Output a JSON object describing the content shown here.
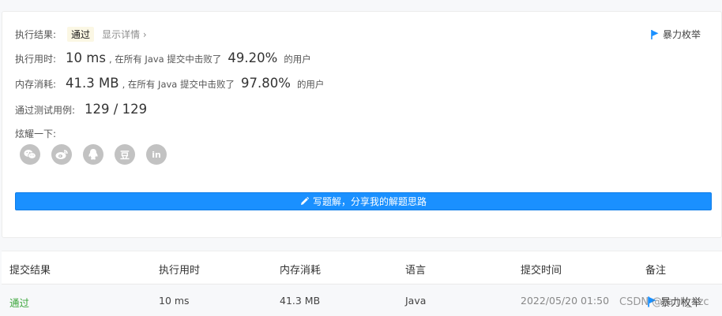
{
  "result": {
    "label": "执行结果:",
    "status": "通过",
    "detail_link": "显示详情",
    "detail_chevron": "›",
    "brute_label": "暴力枚举"
  },
  "runtime": {
    "label": "执行用时:",
    "value": "10 ms",
    "middle": ", 在所有 Java 提交中击败了",
    "percent": "49.20%",
    "suffix": "的用户"
  },
  "memory": {
    "label": "内存消耗:",
    "value": "41.3 MB",
    "middle": ", 在所有 Java 提交中击败了",
    "percent": "97.80%",
    "suffix": "的用户"
  },
  "tests": {
    "label": "通过测试用例:",
    "value": "129 / 129"
  },
  "share": {
    "label": "炫耀一下:",
    "icons": [
      "wechat-icon",
      "weibo-icon",
      "qq-icon",
      "douban-icon",
      "linkedin-icon"
    ],
    "douban_glyph": "豆",
    "linkedin_glyph": "in"
  },
  "write_button": {
    "label": "写题解，分享我的解题思路",
    "icon": "pencil-icon"
  },
  "table": {
    "headers": [
      "提交结果",
      "执行用时",
      "内存消耗",
      "语言",
      "提交时间",
      "备注"
    ],
    "row": {
      "status": "通过",
      "runtime": "10 ms",
      "memory": "41.3 MB",
      "language": "Java",
      "time": "2022/05/20 01:50",
      "note": "暴力枚举"
    }
  },
  "watermark": "CSDN @Faith_xzc",
  "colors": {
    "accent": "#1a90ff",
    "pass_green": "#3ca63c",
    "badge_bg": "#fbf7e4",
    "social_grey": "#c2c2c2"
  }
}
